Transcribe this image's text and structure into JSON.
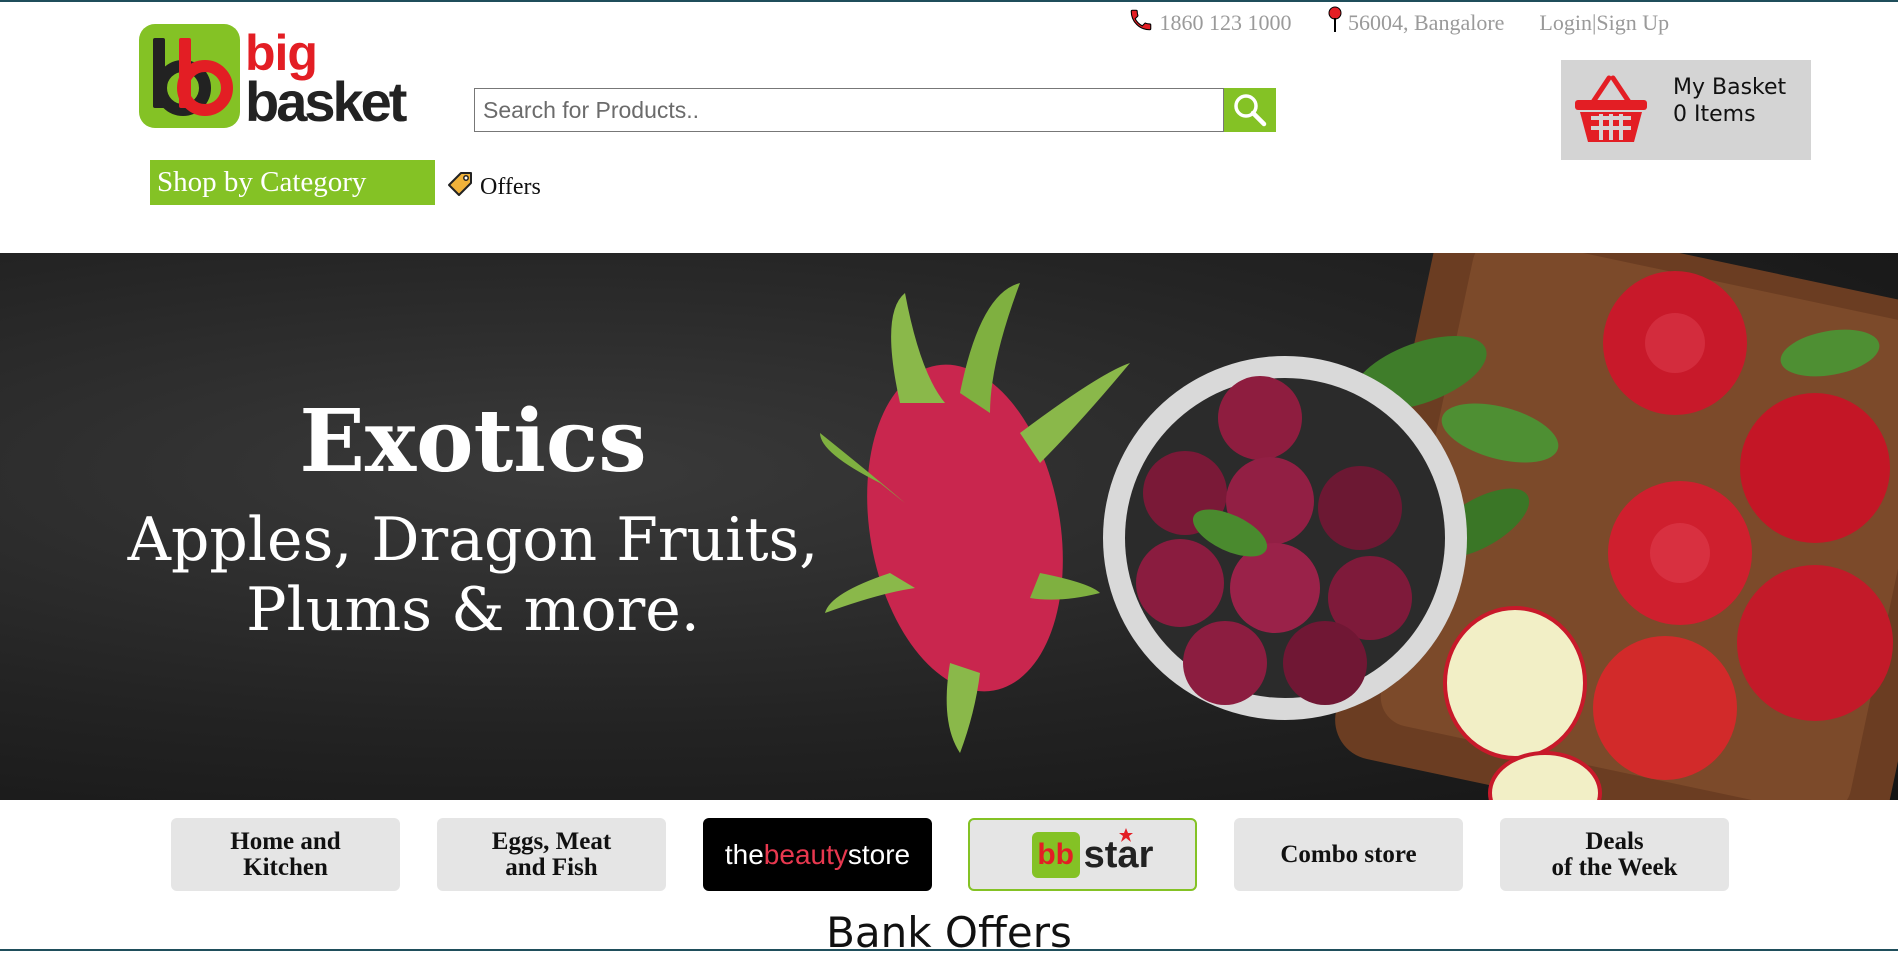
{
  "brand": {
    "mark": "bb",
    "line1": "big",
    "line2": "basket"
  },
  "top_links": {
    "phone": "1860 123 1000",
    "location": "56004, Bangalore",
    "login": "Login",
    "separator": "|",
    "signup": "Sign Up"
  },
  "search": {
    "placeholder": "Search for Products..",
    "button_icon": "search-icon"
  },
  "basket": {
    "title": "My Basket",
    "count_text": "0 Items",
    "icon": "basket-icon"
  },
  "nav": {
    "shop_by_category": "Shop by Category",
    "offers": "Offers",
    "offers_icon": "tag-icon"
  },
  "banner": {
    "title": "Exotics",
    "subtitle_line1": "Apples, Dragon Fruits,",
    "subtitle_line2": "Plums & more."
  },
  "tiles": [
    {
      "line1": "Home and",
      "line2": "Kitchen"
    },
    {
      "line1": "Eggs, Meat",
      "line2": "and Fish"
    },
    {
      "prefix": "the",
      "accent": "beauty",
      "suffix": "store"
    },
    {
      "mark": "bb",
      "label": "star"
    },
    {
      "line1": "Combo store"
    },
    {
      "line1": "Deals",
      "line2": "of the Week"
    }
  ],
  "bank_offers": {
    "title": "Bank Offers"
  },
  "colors": {
    "brand_green": "#84c225",
    "brand_red": "#e31e24",
    "basket_bg": "#d4d4d4",
    "tile_bg": "#e5e5e5"
  }
}
